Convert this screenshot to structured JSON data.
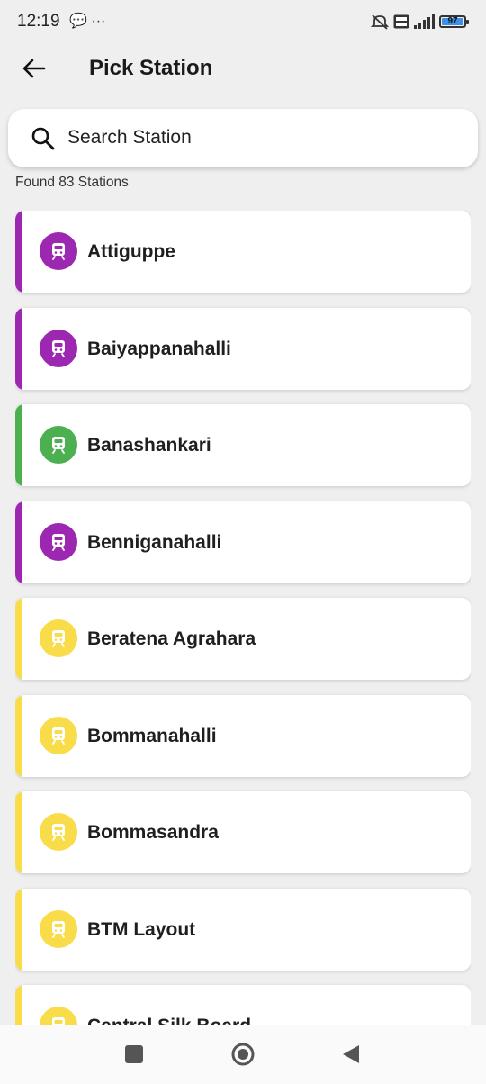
{
  "status": {
    "time": "12:19",
    "left_icons": "💬 ···",
    "battery": "97"
  },
  "appbar": {
    "title": "Pick Station",
    "back_icon": "arrow-left-icon"
  },
  "search": {
    "placeholder": "Search Station",
    "value": "",
    "icon": "search-icon"
  },
  "found_text": "Found 83 Stations",
  "line_colors": {
    "purple": "#9c27b0",
    "green": "#4caf50",
    "yellow": "#f9dc4a"
  },
  "stations": [
    {
      "name": "Attiguppe",
      "line": "purple"
    },
    {
      "name": "Baiyappanahalli",
      "line": "purple"
    },
    {
      "name": "Banashankari",
      "line": "green"
    },
    {
      "name": "Benniganahalli",
      "line": "purple"
    },
    {
      "name": "Beratena Agrahara",
      "line": "yellow"
    },
    {
      "name": "Bommanahalli",
      "line": "yellow"
    },
    {
      "name": "Bommasandra",
      "line": "yellow"
    },
    {
      "name": "BTM Layout",
      "line": "yellow"
    },
    {
      "name": "Central Silk Board",
      "line": "yellow"
    }
  ],
  "navbar": {
    "recent_icon": "square-icon",
    "home_icon": "circle-icon",
    "back_icon": "triangle-back-icon"
  }
}
